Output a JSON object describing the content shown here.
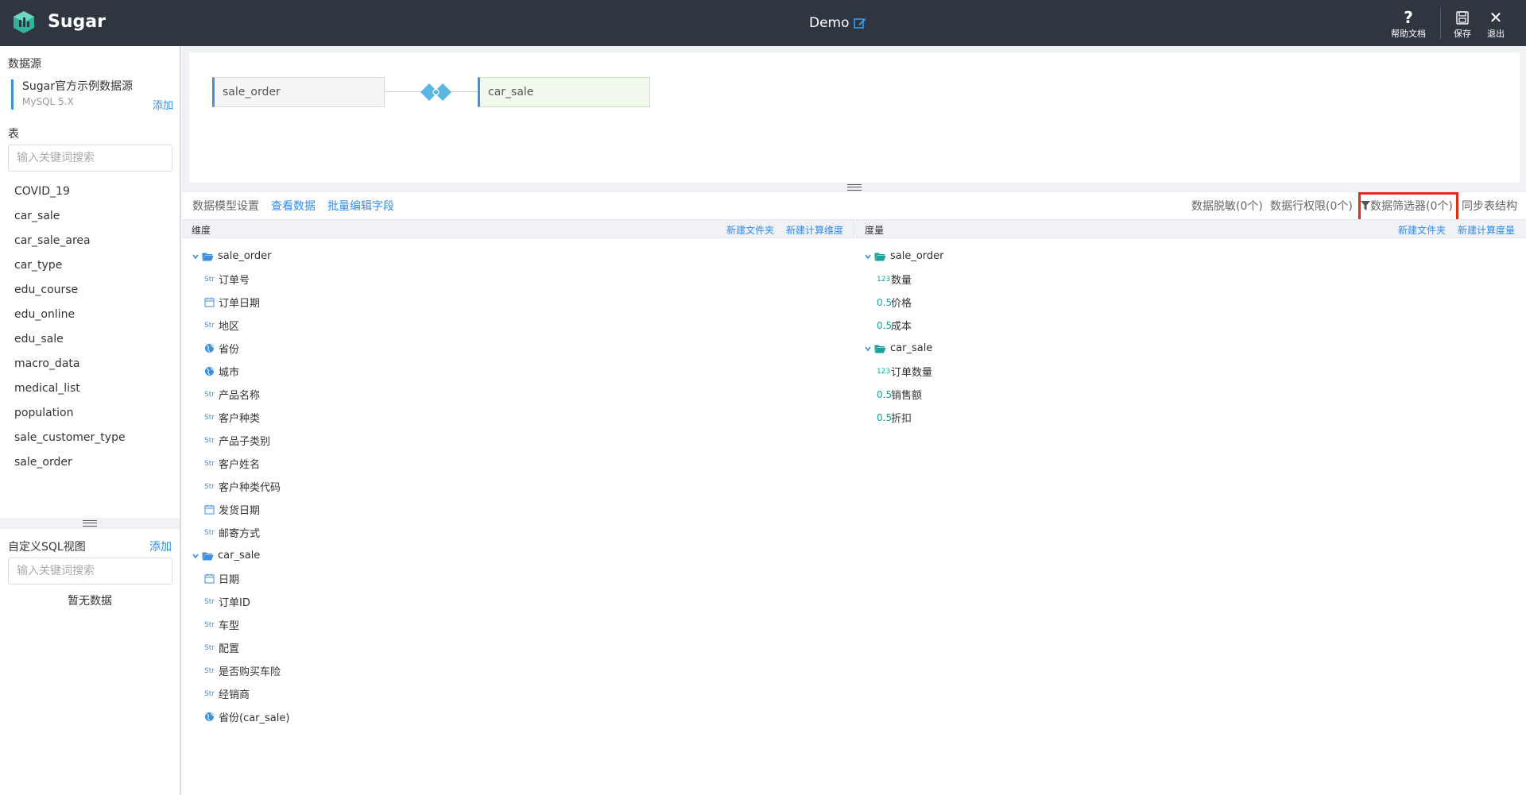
{
  "header": {
    "brand": "Sugar",
    "title": "Demo",
    "help_label": "帮助文档",
    "save_label": "保存",
    "exit_label": "退出",
    "help_glyph": "?",
    "exit_glyph": "✕"
  },
  "sidebar": {
    "datasource_heading": "数据源",
    "datasource_name": "Sugar官方示例数据源",
    "datasource_type": "MySQL 5.X",
    "datasource_add": "添加",
    "table_heading": "表",
    "table_search_placeholder": "输入关键词搜索",
    "tables": [
      "COVID_19",
      "car_sale",
      "car_sale_area",
      "car_type",
      "edu_course",
      "edu_online",
      "edu_sale",
      "macro_data",
      "medical_list",
      "population",
      "sale_customer_type",
      "sale_order"
    ],
    "sql_heading": "自定义SQL视图",
    "sql_add": "添加",
    "sql_search_placeholder": "输入关键词搜索",
    "sql_empty": "暂无数据"
  },
  "canvas": {
    "left_table": "sale_order",
    "right_table": "car_sale",
    "join_color": "#5bb5e0"
  },
  "toolbar": {
    "tab_model": "数据模型设置",
    "tab_view": "查看数据",
    "tab_batch": "批量编辑字段",
    "masking": "数据脱敏(0个)",
    "row_perm": "数据行权限(0个)",
    "filter": "数据筛选器(0个)",
    "sync": "同步表结构",
    "highlight_color": "#e8261a"
  },
  "dimensions": {
    "title": "维度",
    "new_folder": "新建文件夹",
    "new_calc": "新建计算维度",
    "groups": [
      {
        "name": "sale_order",
        "fields": [
          {
            "type": "Str",
            "name": "订单号"
          },
          {
            "type": "date",
            "name": "订单日期"
          },
          {
            "type": "Str",
            "name": "地区"
          },
          {
            "type": "geo",
            "name": "省份"
          },
          {
            "type": "geo",
            "name": "城市"
          },
          {
            "type": "Str",
            "name": "产品名称"
          },
          {
            "type": "Str",
            "name": "客户种类"
          },
          {
            "type": "Str",
            "name": "产品子类别"
          },
          {
            "type": "Str",
            "name": "客户姓名"
          },
          {
            "type": "Str",
            "name": "客户种类代码"
          },
          {
            "type": "date",
            "name": "发货日期"
          },
          {
            "type": "Str",
            "name": "邮寄方式"
          }
        ]
      },
      {
        "name": "car_sale",
        "fields": [
          {
            "type": "date",
            "name": "日期"
          },
          {
            "type": "Str",
            "name": "订单ID"
          },
          {
            "type": "Str",
            "name": "车型"
          },
          {
            "type": "Str",
            "name": "配置"
          },
          {
            "type": "Str",
            "name": "是否购买车险"
          },
          {
            "type": "Str",
            "name": "经销商"
          },
          {
            "type": "geo",
            "name": "省份(car_sale)"
          }
        ]
      }
    ]
  },
  "measures": {
    "title": "度量",
    "new_folder": "新建文件夹",
    "new_calc": "新建计算度量",
    "groups": [
      {
        "name": "sale_order",
        "fields": [
          {
            "type": "123",
            "name": "数量"
          },
          {
            "type": "0.5",
            "name": "价格"
          },
          {
            "type": "0.5",
            "name": "成本"
          }
        ]
      },
      {
        "name": "car_sale",
        "fields": [
          {
            "type": "123",
            "name": "订单数量"
          },
          {
            "type": "0.5",
            "name": "销售额"
          },
          {
            "type": "0.5",
            "name": "折扣"
          }
        ]
      }
    ]
  },
  "colors": {
    "header_bg": "#2f3640",
    "accent": "#2d8cf0",
    "dim_folder": "#3d8fe0",
    "mea_folder": "#1aa39a"
  }
}
